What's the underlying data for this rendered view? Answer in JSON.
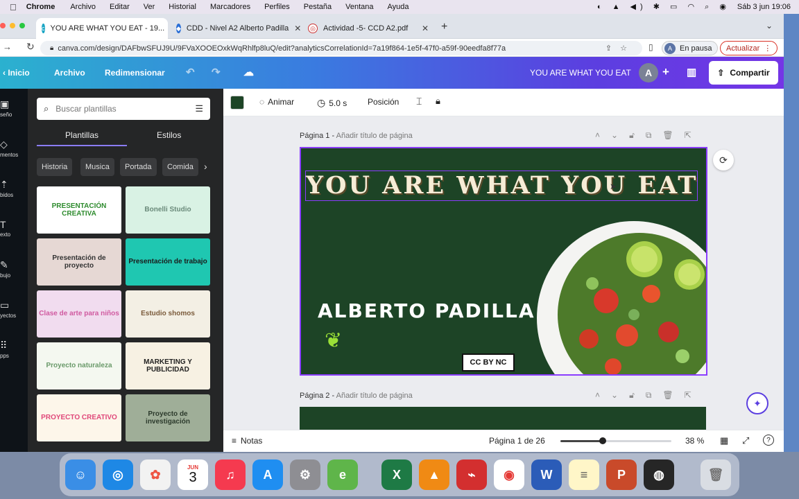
{
  "menubar": {
    "apple": "",
    "app": "Chrome",
    "items": [
      "Archivo",
      "Editar",
      "Ver",
      "Historial",
      "Marcadores",
      "Perfiles",
      "Pestaña",
      "Ventana",
      "Ayuda"
    ],
    "clock": "Sáb 3 jun  19:06"
  },
  "tabs": [
    {
      "title": "YOU ARE WHAT YOU EAT - 19...",
      "active": true
    },
    {
      "title": "CDD - Nivel A2 Alberto Padilla",
      "active": false
    },
    {
      "title": "Actividad -5- CCD A2.pdf",
      "active": false
    }
  ],
  "browser": {
    "url": "canva.com/design/DAFbwSFUJ9U/9FVaXOOEOxkWqRhlfp8luQ/edit?analyticsCorrelationId=7a19f864-1e5f-47f0-a59f-90eedfa8f77a",
    "paused_label": "En pausa",
    "update_label": "Actualizar"
  },
  "canva_bar": {
    "home": "Inicio",
    "file": "Archivo",
    "resize": "Redimensionar",
    "doc_title": "YOU ARE WHAT YOU EAT",
    "avatar": "A",
    "share": "Compartir"
  },
  "rail": [
    {
      "icon": "layout-icon",
      "label": "seño"
    },
    {
      "icon": "elements-icon",
      "label": "mentos"
    },
    {
      "icon": "upload-icon",
      "label": "bidos"
    },
    {
      "icon": "text-icon",
      "label": "exto"
    },
    {
      "icon": "draw-icon",
      "label": "bujo"
    },
    {
      "icon": "projects-icon",
      "label": "yectos"
    },
    {
      "icon": "apps-icon",
      "label": "pps"
    }
  ],
  "panel": {
    "search_placeholder": "Buscar plantillas",
    "tab_templates": "Plantillas",
    "tab_styles": "Estilos",
    "chips": [
      "Historia",
      "Musica",
      "Portada",
      "Comida"
    ],
    "thumbnails": [
      {
        "text": "PRESENTACIÓN CREATIVA",
        "bg": "#ffffff",
        "fg": "#2e8b2e"
      },
      {
        "text": "Bonelli Studio",
        "bg": "#d9f2e4",
        "fg": "#6a8a7a"
      },
      {
        "text": "Presentación de proyecto",
        "bg": "#e6d8d4",
        "fg": "#333333"
      },
      {
        "text": "Presentación de trabajo",
        "bg": "#1fc7b1",
        "fg": "#1a1a1a"
      },
      {
        "text": "Clase de arte para niños",
        "bg": "#f1dcef",
        "fg": "#d05aa0"
      },
      {
        "text": "Estudio shomos",
        "bg": "#f3efe4",
        "fg": "#7a5a3a"
      },
      {
        "text": "Proyecto naturaleza",
        "bg": "#f4f8f0",
        "fg": "#6a9a6a"
      },
      {
        "text": "MARKETING Y PUBLICIDAD",
        "bg": "#f7f1e3",
        "fg": "#222222"
      },
      {
        "text": "PROYECTO CREATIVO",
        "bg": "#fdf6ea",
        "fg": "#e0487a"
      },
      {
        "text": "Proyecto de investigación",
        "bg": "#9fae98",
        "fg": "#2c3a2c"
      }
    ]
  },
  "toolbar": {
    "color": "#1d4426",
    "animate": "Animar",
    "duration": "5.0 s",
    "position": "Posición"
  },
  "pages": {
    "page1_label": "Página 1 -",
    "page1_add": "Añadir título de página",
    "page2_label": "Página 2 -",
    "page2_add": "Añadir título de página"
  },
  "slide": {
    "title": "YOU ARE WHAT YOU EAT",
    "author": "ALBERTO PADILLA",
    "license": "CC BY NC",
    "bg": "#1d4426"
  },
  "bottom": {
    "notes": "Notas",
    "page_counter": "Página 1 de 26",
    "zoom": "38 %",
    "zoom_level": 0.38
  },
  "dock": {
    "calendar_month": "JUN",
    "calendar_day": "3"
  }
}
